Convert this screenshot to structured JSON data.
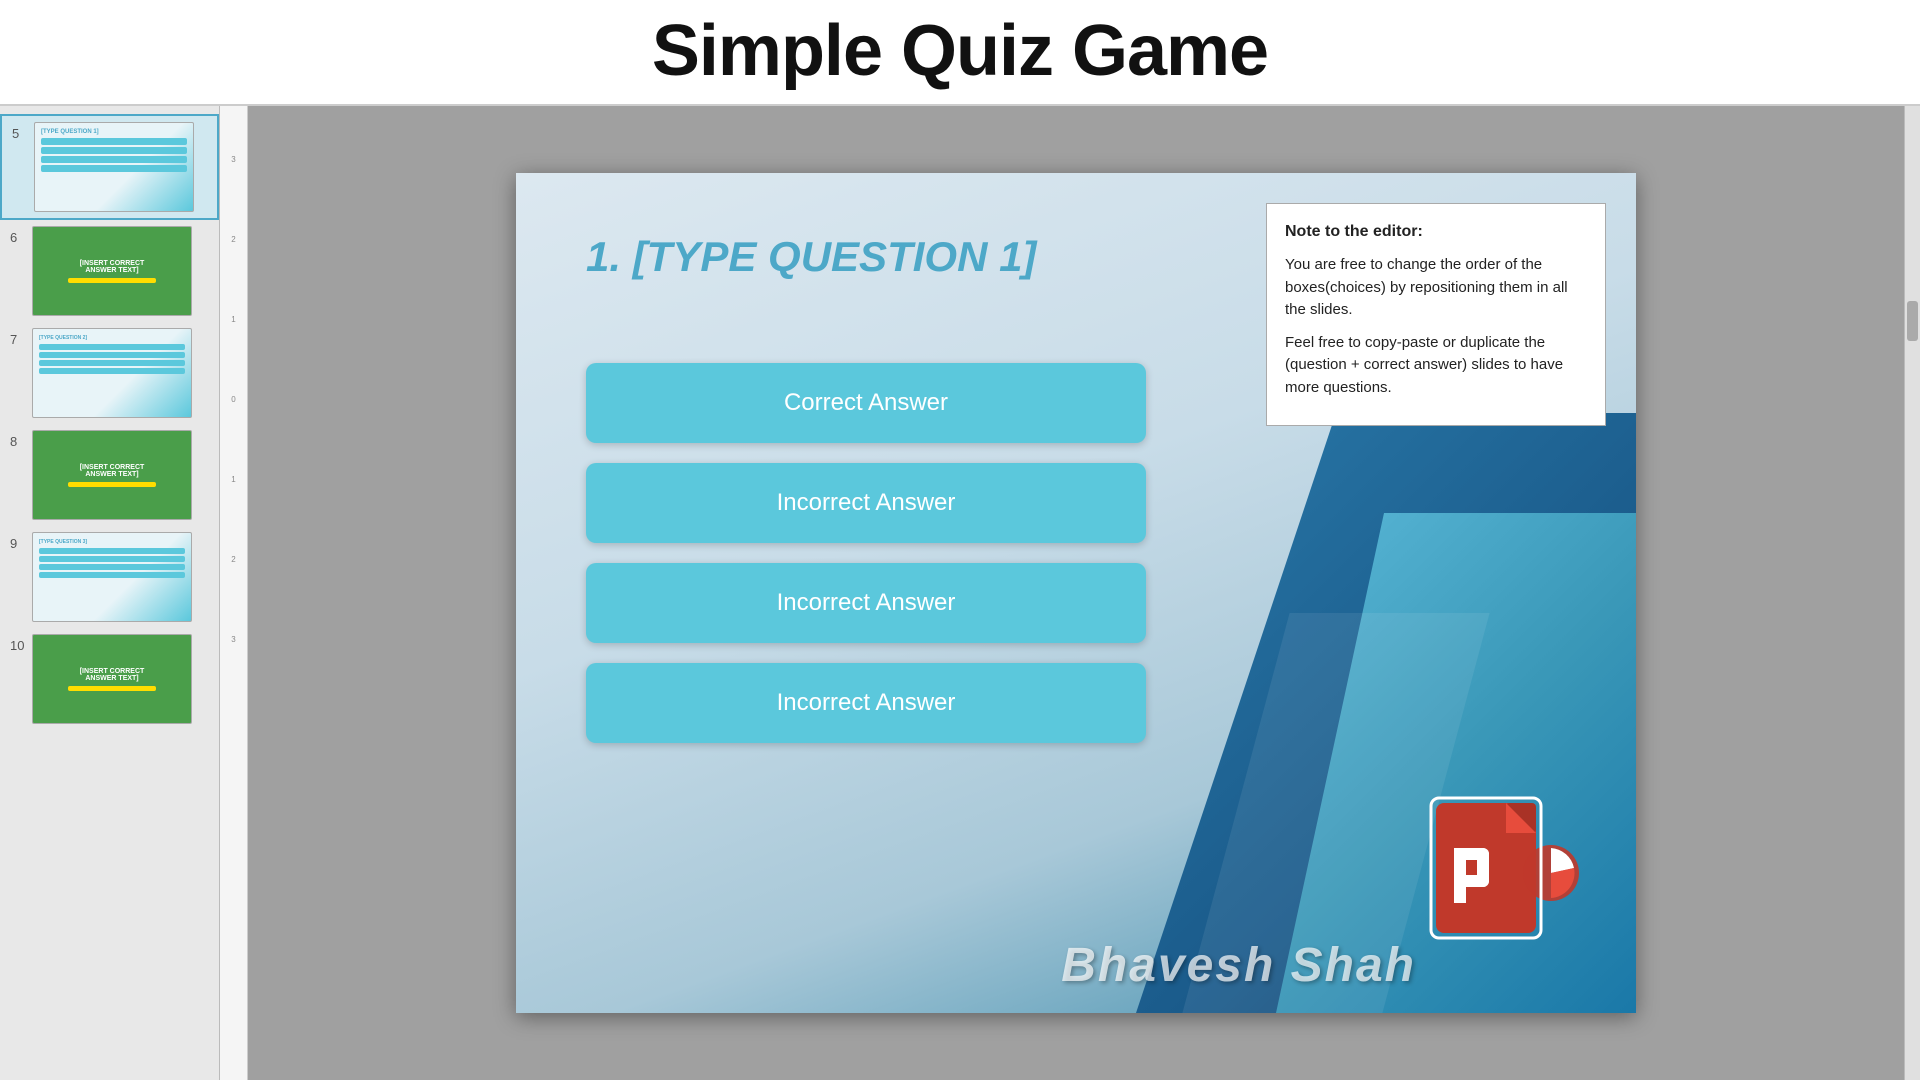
{
  "title_bar": {
    "title": "Simple Quiz Game"
  },
  "sidebar": {
    "slides": [
      {
        "num": "5",
        "type": "question",
        "active": true,
        "theme": "blue"
      },
      {
        "num": "6",
        "type": "correct",
        "active": false,
        "theme": "green",
        "label": "[INSERT CORRECT\nANSWER TEXT]"
      },
      {
        "num": "7",
        "type": "question",
        "active": false,
        "theme": "blue"
      },
      {
        "num": "8",
        "type": "correct",
        "active": false,
        "theme": "green",
        "label": "[INSERT CORRECT\nANSWER TEXT]"
      },
      {
        "num": "9",
        "type": "question",
        "active": false,
        "theme": "blue"
      },
      {
        "num": "10",
        "type": "correct",
        "active": false,
        "theme": "green",
        "label": "[INSERT CORRECT\nANSWER TEXT]"
      }
    ]
  },
  "slide": {
    "question": "1.  [TYPE QUESTION 1]",
    "answers": [
      {
        "label": "Correct Answer",
        "type": "correct"
      },
      {
        "label": "Incorrect Answer",
        "type": "incorrect"
      },
      {
        "label": "Incorrect Answer",
        "type": "incorrect"
      },
      {
        "label": "Incorrect Answer",
        "type": "incorrect"
      }
    ],
    "note": {
      "title": "Note to the editor:",
      "para1": "You are free to change the order of the boxes(choices) by repositioning them in all the slides.",
      "para2": "Feel free to copy-paste or duplicate the (question + correct answer) slides to have more questions."
    },
    "watermark": "Bhavesh Shah"
  },
  "colors": {
    "answer_btn": "#5bc8dc",
    "question_text": "#4da8c8",
    "correct_green": "#4a9e4a",
    "wrong_red": "#c0392b"
  }
}
